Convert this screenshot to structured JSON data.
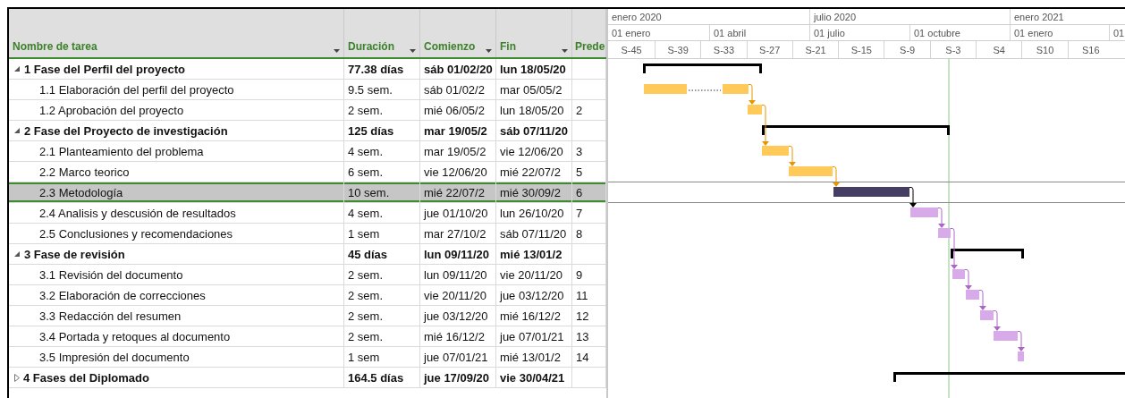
{
  "columns": [
    {
      "label": "Nombre de tarea",
      "has_menu": true
    },
    {
      "label": "Duración",
      "has_menu": true
    },
    {
      "label": "Comienzo",
      "has_menu": true
    },
    {
      "label": "Fin",
      "has_menu": true
    },
    {
      "label": "Prede"
    }
  ],
  "timescale": {
    "top_tier": [
      "enero 2020",
      "julio 2020",
      "enero 2021"
    ],
    "middle_tier": [
      "01 enero",
      "01 abril",
      "01 julio",
      "01 octubre",
      "01 enero",
      "01"
    ],
    "bottom_tier": [
      "S-45",
      "S-39",
      "S-33",
      "S-27",
      "S-21",
      "S-15",
      "S-9",
      "S-3",
      "S4",
      "S10",
      "S16"
    ]
  },
  "tasks": [
    {
      "kind": "summary",
      "name": "1 Fase del Perfil del proyecto",
      "duration": "77.38 días",
      "start": "sáb 01/02/20",
      "end": "lun 18/05/20",
      "selected": false,
      "expanded": true,
      "children": [
        {
          "kind": "split",
          "name": "1.1 Elaboración del perfil del proyecto",
          "duration": "9.5 sem.",
          "start": "sáb 01/02/2",
          "end": "mar 05/05/2",
          "selected": false,
          "color": "#ffca5a"
        },
        {
          "kind": "task",
          "name": "1.2 Aprobación del proyecto",
          "duration": "2 sem.",
          "start": "mié 06/05/2",
          "end": "lun 18/05/20",
          "predecessors": "2",
          "selected": false,
          "color": "#ffca5a"
        }
      ]
    },
    {
      "kind": "summary",
      "name": "2 Fase del Proyecto de investigación",
      "duration": "125 días",
      "start": "mar 19/05/2",
      "end": "sáb 07/11/20",
      "selected": false,
      "expanded": true,
      "children": [
        {
          "kind": "task",
          "name": "2.1 Planteamiento del problema",
          "duration": "4 sem.",
          "start": "mar 19/05/2",
          "end": "vie 12/06/20",
          "predecessors": "3",
          "selected": false,
          "color": "#ffca5a"
        },
        {
          "kind": "task",
          "name": "2.2 Marco teorico",
          "duration": "6 sem.",
          "start": "vie 12/06/20",
          "end": "mié 22/07/2",
          "predecessors": "5",
          "selected": false,
          "color": "#ffca5a"
        },
        {
          "kind": "task",
          "name": "2.3 Metodología",
          "duration": "10 sem.",
          "start": "mié 22/07/2",
          "end": "mié 30/09/2",
          "predecessors": "6",
          "selected": true
        },
        {
          "kind": "task",
          "name": "2.4 Analisis y descusión de resultados",
          "duration": "4 sem.",
          "start": "jue 01/10/20",
          "end": "lun 26/10/20",
          "predecessors": "7",
          "selected": false,
          "color": "#d9aaea"
        },
        {
          "kind": "task",
          "name": "2.5 Conclusiones y recomendaciones",
          "duration": "1 sem",
          "start": "mar 27/10/2",
          "end": "sáb 07/11/20",
          "predecessors": "8",
          "selected": false,
          "color": "#d9aaea"
        }
      ]
    },
    {
      "kind": "summary",
      "name": "3 Fase de revisión",
      "duration": "45 días",
      "start": "lun 09/11/20",
      "end": "mié 13/01/2",
      "selected": false,
      "expanded": true,
      "children": [
        {
          "kind": "task",
          "name": "3.1 Revisión del documento",
          "duration": "2 sem.",
          "start": "lun 09/11/20",
          "end": "vie 20/11/20",
          "predecessors": "9",
          "selected": false,
          "color": "#d9aaea"
        },
        {
          "kind": "task",
          "name": "3.2 Elaboración de correcciones",
          "duration": "2 sem.",
          "start": "vie 20/11/20",
          "end": "jue 03/12/20",
          "predecessors": "11",
          "selected": false,
          "color": "#d9aaea"
        },
        {
          "kind": "task",
          "name": "3.3 Redacción del resumen",
          "duration": "2 sem.",
          "start": "jue 03/12/20",
          "end": "mié 16/12/2",
          "predecessors": "12",
          "selected": false,
          "color": "#d9aaea"
        },
        {
          "kind": "task",
          "name": "3.4 Portada y retoques al documento",
          "duration": "2 sem.",
          "start": "mié 16/12/2",
          "end": "jue 07/01/21",
          "predecessors": "13",
          "selected": false,
          "color": "#d9aaea"
        },
        {
          "kind": "task",
          "name": "3.5 Impresión del documento",
          "duration": "1 sem",
          "start": "jue 07/01/21",
          "end": "mié 13/01/2",
          "predecessors": "14",
          "selected": false,
          "color": "#d9aaea"
        }
      ]
    },
    {
      "kind": "summary",
      "name": "4 Fases del Diplomado",
      "duration": "164.5 días",
      "start": "jue 17/09/20",
      "end": "vie 30/04/21",
      "selected": false,
      "expanded": false
    }
  ]
}
